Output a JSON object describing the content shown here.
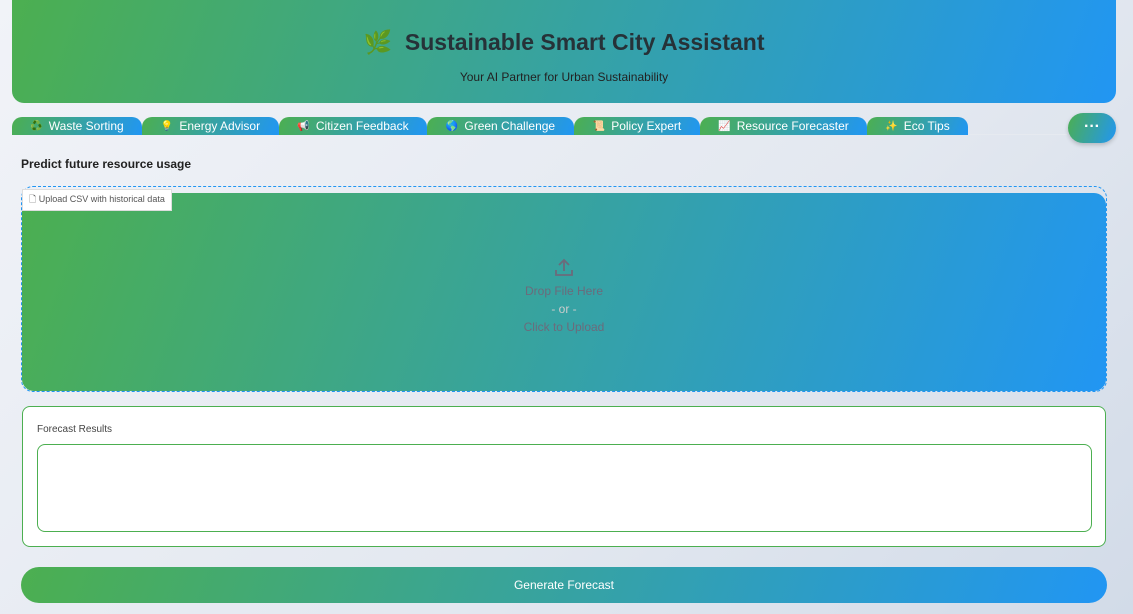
{
  "header": {
    "icon": "🌿",
    "title": "Sustainable Smart City Assistant",
    "subtitle": "Your AI Partner for Urban Sustainability"
  },
  "tabs": [
    {
      "icon": "♻️",
      "label": "Waste Sorting"
    },
    {
      "icon": "💡",
      "label": "Energy Advisor"
    },
    {
      "icon": "📢",
      "label": "Citizen Feedback"
    },
    {
      "icon": "🌎",
      "label": "Green Challenge"
    },
    {
      "icon": "📜",
      "label": "Policy Expert"
    },
    {
      "icon": "📈",
      "label": "Resource Forecaster"
    },
    {
      "icon": "✨",
      "label": "Eco Tips"
    }
  ],
  "more_label": "···",
  "section_title": "Predict future resource usage",
  "upload": {
    "label": "Upload CSV with historical data",
    "drop": "Drop File Here",
    "or": "- or -",
    "click": "Click to Upload"
  },
  "results": {
    "label": "Forecast Results",
    "value": ""
  },
  "generate_label": "Generate Forecast",
  "colors": {
    "green": "#4caf50",
    "blue": "#2196f3"
  }
}
